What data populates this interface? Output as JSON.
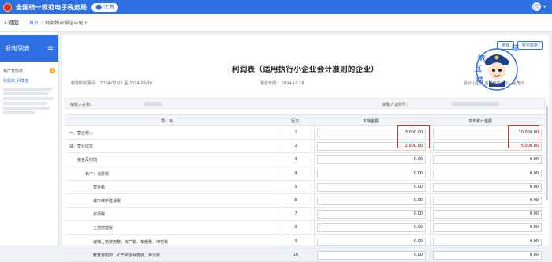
{
  "topbar": {
    "site_title": "全国统一规范电子税务局",
    "region": "江苏"
  },
  "navbar": {
    "back": "返回",
    "crumb_home": "首页",
    "crumb_current": "财务报表报送与更正"
  },
  "sidebar": {
    "title": "报表列表",
    "group_label": "资产负债表",
    "group_badge": "2",
    "active_item": "利润表_月季度"
  },
  "toolbar": {
    "save_label": "重置",
    "data_label": "财务数据"
  },
  "mascot_text": [
    "征",
    "纳",
    "互",
    "动"
  ],
  "form": {
    "title": "利润表（适用执行小企业会计准则的企业）",
    "period_label": "税款所属期间：",
    "period_start": "2024-07-01",
    "period_to": "至",
    "period_end": "2024-09-30",
    "fill_date_label": "报送日期：",
    "fill_date": "2024-10-18",
    "unit_label": "会计小企业",
    "currency_label": "金额单位：元，至角分"
  },
  "info": {
    "taxpayer_name_label": "纳税人名称：",
    "taxpayer_id_label": "纳税人识别号："
  },
  "table": {
    "headers": [
      "项　目",
      "行次",
      "本期金额",
      "本年累计金额"
    ],
    "rows": [
      {
        "name": "一、营业收入",
        "no": "1",
        "current": "3,000.00",
        "ytd": "10,000.00"
      },
      {
        "name": "减：营业成本",
        "no": "2",
        "current": "2,000.00",
        "ytd": "5,000.00"
      },
      {
        "name": "税金及附加",
        "no": "3",
        "current": "0.00",
        "ytd": "0.00"
      },
      {
        "name": "其中：消费税",
        "no": "4",
        "current": "0.00",
        "ytd": "0.00"
      },
      {
        "name": "营业税",
        "no": "5",
        "current": "0.00",
        "ytd": "0.00"
      },
      {
        "name": "城市维护建设税",
        "no": "6",
        "current": "0.00",
        "ytd": "0.00"
      },
      {
        "name": "资源税",
        "no": "7",
        "current": "0.00",
        "ytd": "0.00"
      },
      {
        "name": "土地增值税",
        "no": "8",
        "current": "0.00",
        "ytd": "0.00"
      },
      {
        "name": "城镇土地使用税、房产税、车船税、印花税",
        "no": "9",
        "current": "0.00",
        "ytd": "0.00"
      },
      {
        "name": "教育费附加、矿产资源补偿费、排污费",
        "no": "10",
        "current": "0.00",
        "ytd": "0.00"
      }
    ]
  }
}
